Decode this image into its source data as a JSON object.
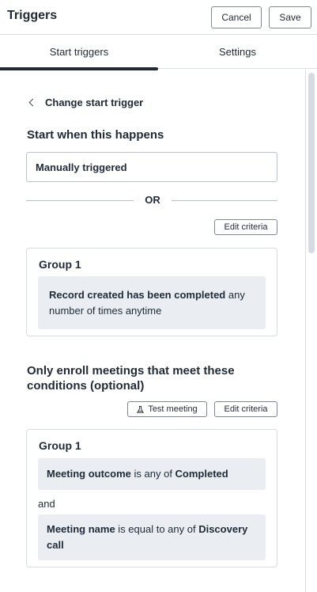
{
  "header": {
    "title": "Triggers",
    "cancel_label": "Cancel",
    "save_label": "Save"
  },
  "tabs": [
    {
      "label": "Start triggers",
      "active": true
    },
    {
      "label": "Settings",
      "active": false
    }
  ],
  "start_section": {
    "back_label": "Change start trigger",
    "heading": "Start when this happens",
    "trigger_value": "Manually triggered",
    "separator": "OR",
    "edit_criteria_label": "Edit criteria",
    "group": {
      "title": "Group 1",
      "condition": {
        "bold": "Record created has been completed",
        "rest": " any number of times anytime"
      }
    }
  },
  "enroll_section": {
    "heading": "Only enroll meetings that meet these conditions (optional)",
    "test_label": "Test meeting",
    "edit_criteria_label": "Edit criteria",
    "group": {
      "title": "Group 1",
      "conditions": [
        {
          "property": "Meeting outcome",
          "operator": " is any of ",
          "value": "Completed"
        },
        {
          "property": "Meeting name",
          "operator": " is equal to any of ",
          "value": "Discovery call"
        }
      ],
      "joiner": "and"
    }
  },
  "icons": {
    "back": "chevron-left-icon",
    "test": "flask-icon"
  },
  "colors": {
    "text": "#1f2a36",
    "border": "#7c8896",
    "condition_bg": "#eaeef2",
    "tab_indicator": "#1f2a36"
  }
}
